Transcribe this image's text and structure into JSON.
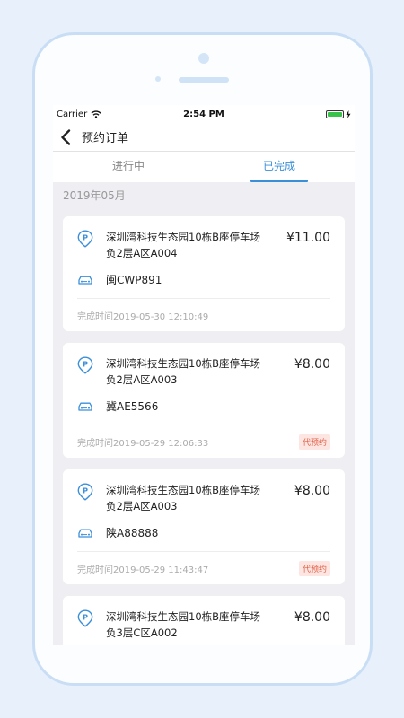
{
  "status": {
    "carrier": "Carrier",
    "time": "2:54 PM"
  },
  "nav": {
    "title": "预约订单"
  },
  "tabs": [
    {
      "label": "进行中",
      "active": false
    },
    {
      "label": "已完成",
      "active": true
    }
  ],
  "month": "2019年05月",
  "orders": [
    {
      "address_line1": "深圳湾科技生态园10栋B座停车场",
      "address_line2": "负2层A区A004",
      "price": "¥11.00",
      "plate": "闽CWP891",
      "completed": "完成时间2019-05-30 12:10:49",
      "badge": ""
    },
    {
      "address_line1": "深圳湾科技生态园10栋B座停车场",
      "address_line2": "负2层A区A003",
      "price": "¥8.00",
      "plate": "冀AE5566",
      "completed": "完成时间2019-05-29 12:06:33",
      "badge": "代预约"
    },
    {
      "address_line1": "深圳湾科技生态园10栋B座停车场",
      "address_line2": "负2层A区A003",
      "price": "¥8.00",
      "plate": "陕A88888",
      "completed": "完成时间2019-05-29 11:43:47",
      "badge": "代预约"
    },
    {
      "address_line1": "深圳湾科技生态园10栋B座停车场",
      "address_line2": "负3层C区A002",
      "price": "¥8.00",
      "plate": "",
      "completed": "",
      "badge": ""
    }
  ],
  "colors": {
    "accent": "#3b8fd9",
    "badge_text": "#e2614a",
    "badge_bg": "#fde6e1",
    "frame": "#c9def5"
  },
  "icons": {
    "pin": "parking-pin-icon",
    "car": "car-icon",
    "back": "back-chevron-icon",
    "wifi": "wifi-icon",
    "battery": "battery-icon"
  }
}
